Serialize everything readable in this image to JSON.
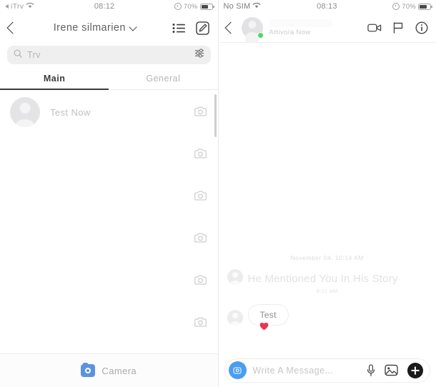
{
  "left": {
    "status_bar": {
      "carrier": "iTrv",
      "time": "08:12",
      "battery_pct": "70%",
      "wifi_icon": "wifi-icon",
      "battery_icon": "battery-icon",
      "alarm_icon": "alarm-icon"
    },
    "nav": {
      "back_icon": "chevron-left-icon",
      "title": "Irene  silmarien",
      "dropdown_icon": "chevron-down-icon",
      "list_icon": "list-icon",
      "compose_icon": "compose-icon"
    },
    "search": {
      "icon": "search-icon",
      "placeholder": "Trv",
      "filter_icon": "sliders-icon"
    },
    "tabs": [
      {
        "label": "Main",
        "active": true
      },
      {
        "label": "General",
        "active": false
      }
    ],
    "conversations": [
      {
        "name": "Test Now",
        "avatar_icon": "person-avatar-icon",
        "camera_icon": "camera-icon"
      }
    ],
    "camera_slots": 6,
    "camera_slot_icon": "camera-icon",
    "bottom_bar": {
      "icon": "camera-icon-blue",
      "label": "Camera",
      "color": "#5b93e0"
    }
  },
  "right": {
    "status_bar": {
      "carrier": "No SIM",
      "time": "08:13",
      "battery_pct": "70%",
      "wifi_icon": "wifi-icon",
      "battery_icon": "battery-icon",
      "alarm_icon": "alarm-icon"
    },
    "header": {
      "back_icon": "chevron-left-icon",
      "avatar_icon": "person-avatar-icon",
      "name": "",
      "status": "Attivo/a Now",
      "online_color": "#4cd964",
      "video_icon": "video-camera-icon",
      "flag_icon": "flag-icon",
      "info_icon": "info-circle-icon"
    },
    "conversation": {
      "day_separator": "November 04, 10:14 AM",
      "messages": [
        {
          "type": "story-mention",
          "avatar_icon": "person-avatar-icon",
          "text": "He Mentioned You In His Story",
          "time": "8:11 AM"
        },
        {
          "type": "bubble",
          "avatar_icon": "person-avatar-icon",
          "text": "Test",
          "reaction": "❤️",
          "reaction_color": "#e8384f"
        }
      ]
    },
    "composer": {
      "camera_icon": "camera-round-icon",
      "placeholder": "Write A Message...",
      "mic_icon": "microphone-icon",
      "gallery_icon": "image-icon",
      "plus_icon": "plus-icon"
    }
  }
}
